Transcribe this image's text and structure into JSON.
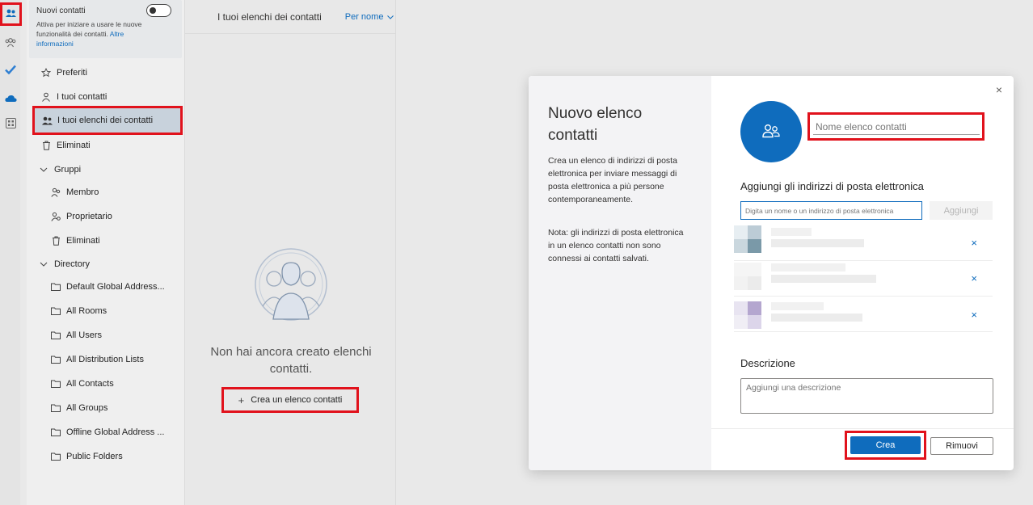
{
  "rail": {
    "items": [
      {
        "icon": "contacts-icon",
        "active": true
      },
      {
        "icon": "groups-icon"
      },
      {
        "icon": "todo-check-icon"
      },
      {
        "icon": "onedrive-cloud-icon"
      },
      {
        "icon": "apps-grid-icon"
      }
    ]
  },
  "banner": {
    "title": "Nuovi contatti",
    "description": "Attiva per iniziare a usare le nuove funzionalità dei contatti.",
    "link": "Altre informazioni"
  },
  "nav": {
    "favorites": "Preferiti",
    "my_contacts": "I tuoi contatti",
    "my_lists": "I tuoi elenchi dei contatti",
    "deleted": "Eliminati",
    "groups": {
      "label": "Gruppi",
      "items": [
        "Membro",
        "Proprietario",
        "Eliminati"
      ]
    },
    "directory": {
      "label": "Directory",
      "items": [
        "Default Global Address...",
        "All Rooms",
        "All Users",
        "All Distribution Lists",
        "All Contacts",
        "All Groups",
        "Offline Global Address ...",
        "Public Folders"
      ]
    }
  },
  "list": {
    "header_title": "I tuoi elenchi dei contatti",
    "sort_label": "Per nome",
    "empty_text": "Non hai ancora creato elenchi contatti.",
    "create_button": "Crea un elenco contatti"
  },
  "dialog": {
    "title": "Nuovo elenco contatti",
    "description": "Crea un elenco di indirizzi di posta elettronica per inviare messaggi di posta elettronica a più persone contemporaneamente.",
    "note": "Nota: gli indirizzi di posta elettronica in un elenco contatti non sono connessi ai contatti salvati.",
    "name_placeholder": "Nome elenco contatti",
    "add_emails_heading": "Aggiungi gli indirizzi di posta elettronica",
    "email_placeholder": "Digita un nome o un indirizzo di posta elettronica",
    "add_button": "Aggiungi",
    "description_heading": "Descrizione",
    "description_placeholder": "Aggiungi una descrizione",
    "create_button": "Crea",
    "remove_button": "Rimuovi",
    "remove_member_glyph": "×",
    "close_glyph": "×",
    "members": [
      {
        "avatar_color": "#7a99a8"
      },
      {
        "avatar_color": "#e2e2e2"
      },
      {
        "avatar_color": "#b4a6cf"
      }
    ]
  },
  "colors": {
    "accent": "#0f6cbd",
    "highlight": "#e1121c"
  }
}
